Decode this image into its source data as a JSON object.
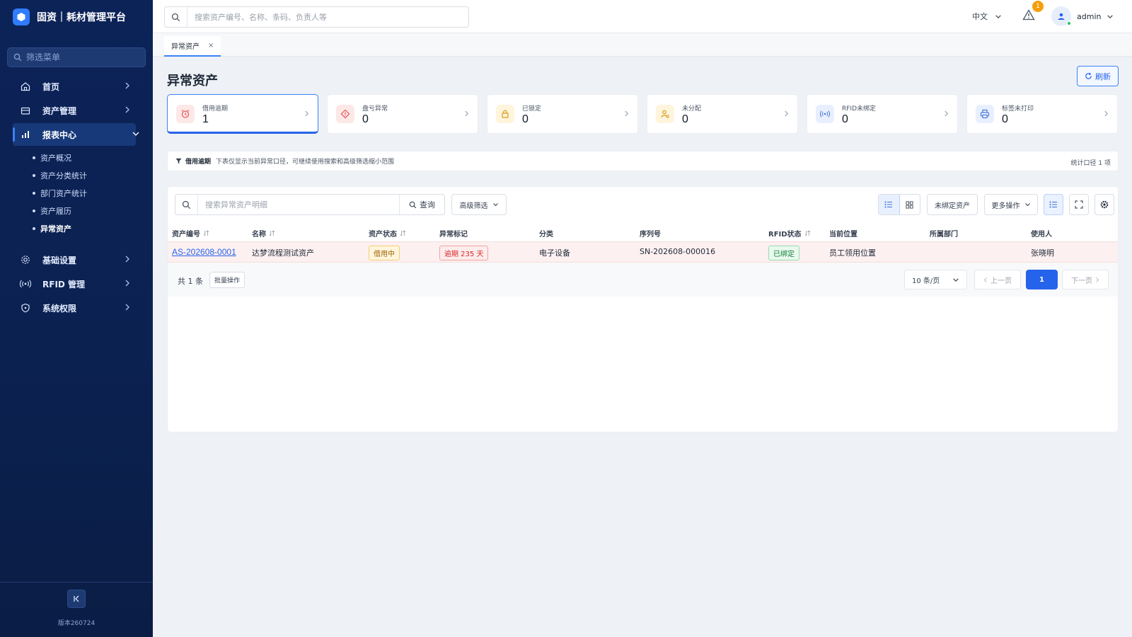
{
  "app": {
    "title": "固资｜耗材管理平台",
    "version": "版本260724"
  },
  "sidebar": {
    "search_placeholder": "筛选菜单",
    "items": [
      {
        "label": "首页"
      },
      {
        "label": "资产管理"
      },
      {
        "label": "报表中心"
      },
      {
        "label": "基础设置"
      },
      {
        "label": "RFID 管理"
      },
      {
        "label": "系统权限"
      }
    ],
    "report_subitems": [
      "资产概况",
      "资产分类统计",
      "部门资产统计",
      "资产履历",
      "异常资产"
    ]
  },
  "header": {
    "search_placeholder": "搜索资产编号、名称、条码、负责人等",
    "language": "中文",
    "alert_count": "1",
    "username": "admin"
  },
  "tabs": [
    {
      "label": "异常资产",
      "close": "×"
    }
  ],
  "page": {
    "title": "异常资产",
    "refresh_label": "刷新"
  },
  "summary_cards": [
    {
      "label": "借用逾期",
      "value": "1"
    },
    {
      "label": "盘亏异常",
      "value": "0"
    },
    {
      "label": "已锁定",
      "value": "0"
    },
    {
      "label": "未分配",
      "value": "0"
    },
    {
      "label": "RFID未绑定",
      "value": "0"
    },
    {
      "label": "标签未打印",
      "value": "0"
    }
  ],
  "notice": {
    "tag": "借用逾期",
    "text": "下表仅显示当前异常口径，可继续使用搜索和高级筛选缩小范围",
    "stat": "统计口径 1 项"
  },
  "toolbar": {
    "search_placeholder": "搜索异常资产明细",
    "query_label": "查询",
    "advanced_label": "高级筛选",
    "unbound_label": "未绑定资产",
    "more_label": "更多操作"
  },
  "table": {
    "columns": [
      "资产编号",
      "名称",
      "资产状态",
      "异常标记",
      "分类",
      "序列号",
      "RFID状态",
      "当前位置",
      "所属部门",
      "使用人"
    ],
    "rows": [
      {
        "asset_no": "AS-202608-0001",
        "name": "达梦流程测试资产",
        "status": "借用中",
        "flag": "逾期 235 天",
        "category": "电子设备",
        "serial": "SN-202608-000016",
        "rfid": "已绑定",
        "location": "员工领用位置",
        "department": "",
        "user": "张晓明"
      }
    ]
  },
  "pagination": {
    "total": "共 1 条",
    "batch_label": "批量操作",
    "page_size": "10 条/页",
    "prev": "上一页",
    "current": "1",
    "next": "下一页"
  },
  "colors": {
    "sidebar_bg": "#0b2150",
    "accent": "#2563eb",
    "overdue_row": "#fdf0f0"
  }
}
